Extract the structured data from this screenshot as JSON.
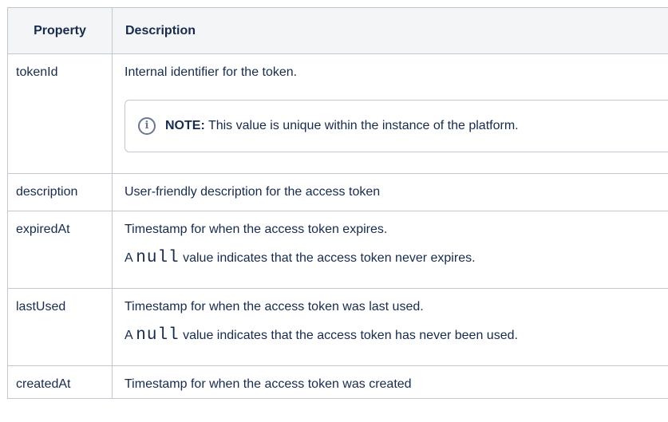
{
  "table": {
    "headers": [
      "Property",
      "Description"
    ],
    "rows": [
      {
        "property": "tokenId",
        "lines": [
          "Internal identifier for the token."
        ],
        "note": {
          "icon": "info-icon",
          "label": "NOTE:",
          "text": "This value is unique within the instance of the platform."
        }
      },
      {
        "property": "description",
        "lines": [
          "User-friendly description for the access token"
        ]
      },
      {
        "property": "expiredAt",
        "lines": [
          "Timestamp for when the access token expires."
        ],
        "extra": {
          "prefix": "A ",
          "code": "null",
          "suffix": " value indicates that the access token never expires."
        }
      },
      {
        "property": "lastUsed",
        "lines": [
          "Timestamp for when the access token was last used."
        ],
        "extra": {
          "prefix": "A ",
          "code": "null",
          "suffix": " value indicates that the access token has never been used."
        }
      },
      {
        "property": "createdAt",
        "lines": [
          "Timestamp for when the access token was created"
        ]
      }
    ]
  }
}
